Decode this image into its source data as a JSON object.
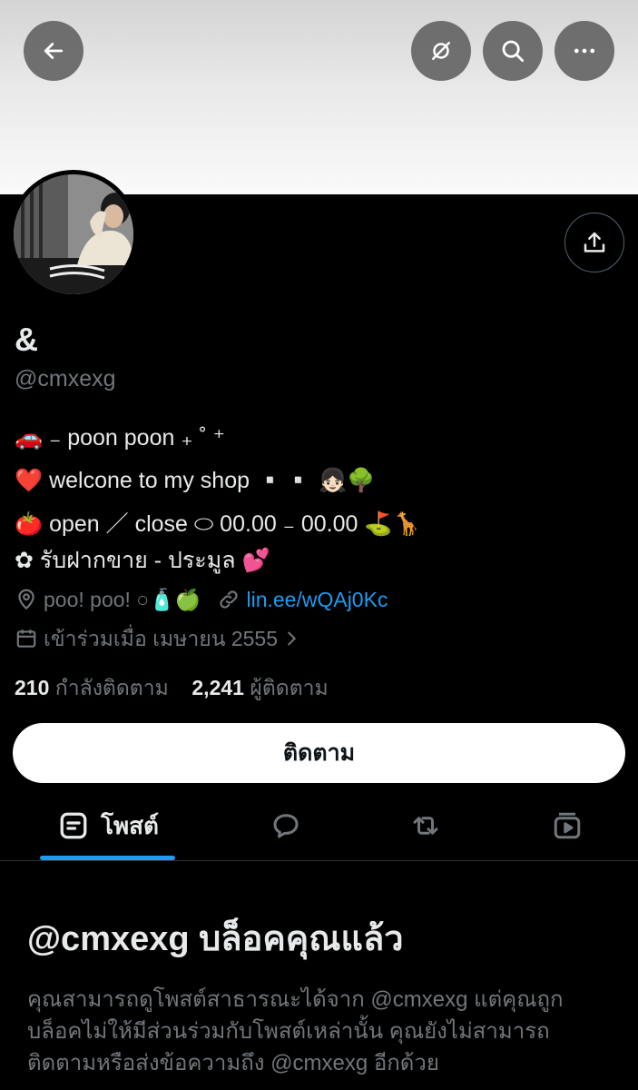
{
  "header": {
    "back_icon": "arrow-left-icon",
    "hidden_icon": "eye-slash-icon",
    "search_icon": "search-icon",
    "more_icon": "more-horizontal-icon"
  },
  "profile": {
    "display_name": "&",
    "handle": "@cmxexg",
    "bio": [
      "🚗 ₋ poon poon ₊ ˚ ⁺",
      "❤️ welcone to my shop ▫️▫️ 👧🏻🌳",
      "🍅 open ／ close ⬭ 00.00 ₋ 00.00 ⛳🦒",
      "✿ รับฝากขาย - ประมูล 💕"
    ],
    "location": "poo! poo! ○🧴🍏",
    "link": "lin.ee/wQAj0Kc",
    "joined": "เข้าร่วมเมื่อ เมษายน 2555",
    "following_count": "210",
    "following_label": "กำลังติดตาม",
    "followers_count": "2,241",
    "followers_label": "ผู้ติดตาม"
  },
  "actions": {
    "follow_label": "ติดตาม",
    "share_icon": "share-icon"
  },
  "tabs": [
    {
      "label": "โพสต์",
      "icon": "posts-icon",
      "active": true
    },
    {
      "label": "",
      "icon": "reply-icon",
      "active": false
    },
    {
      "label": "",
      "icon": "repost-icon",
      "active": false
    },
    {
      "label": "",
      "icon": "media-icon",
      "active": false
    }
  ],
  "blocked": {
    "title": "@cmxexg บล็อคคุณแล้ว",
    "description": "คุณสามารถดูโพสต์สาธารณะได้จาก @cmxexg แต่คุณถูกบล็อคไม่ให้มีส่วนร่วมกับโพสต์เหล่านั้น คุณยังไม่สามารถติดตามหรือส่งข้อความถึง @cmxexg อีกด้วย"
  },
  "colors": {
    "background": "#000000",
    "accent": "#1d9bf0",
    "secondary_text": "#71767b"
  }
}
